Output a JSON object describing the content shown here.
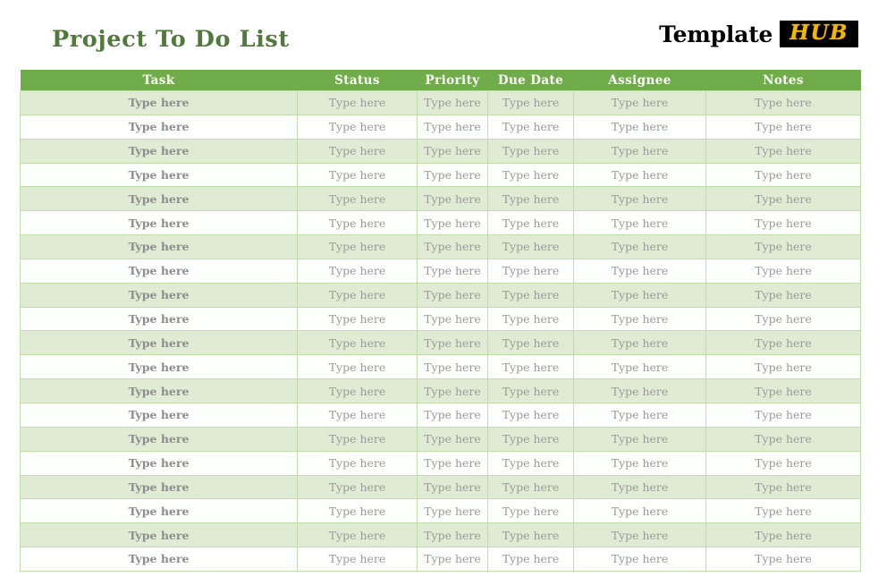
{
  "page": {
    "title": "Project To Do List"
  },
  "brand": {
    "word": "Template",
    "badge": "HUB",
    "badge_color": "#f2b705",
    "badge_bg": "#000000",
    "word_color": "#000000"
  },
  "theme": {
    "title_color": "#4f7a3a",
    "header_bg": "#71ac4a",
    "header_text": "#ffffff",
    "row_alt_bg": "#dfecd3",
    "row_plain_bg": "#fdfffc",
    "border_color": "#c3dcab",
    "cell_text": "#9a9a9a"
  },
  "table": {
    "columns": [
      {
        "key": "task",
        "label": "Task"
      },
      {
        "key": "status",
        "label": "Status"
      },
      {
        "key": "priority",
        "label": "Priority"
      },
      {
        "key": "duedate",
        "label": "Due Date"
      },
      {
        "key": "assignee",
        "label": "Assignee"
      },
      {
        "key": "notes",
        "label": "Notes"
      }
    ],
    "placeholder": "Type here",
    "row_count": 20,
    "rows": [
      {
        "task": "Type here",
        "status": "Type here",
        "priority": "Type here",
        "duedate": "Type here",
        "assignee": "Type here",
        "notes": "Type here"
      },
      {
        "task": "Type here",
        "status": "Type here",
        "priority": "Type here",
        "duedate": "Type here",
        "assignee": "Type here",
        "notes": "Type here"
      },
      {
        "task": "Type here",
        "status": "Type here",
        "priority": "Type here",
        "duedate": "Type here",
        "assignee": "Type here",
        "notes": "Type here"
      },
      {
        "task": "Type here",
        "status": "Type here",
        "priority": "Type here",
        "duedate": "Type here",
        "assignee": "Type here",
        "notes": "Type here"
      },
      {
        "task": "Type here",
        "status": "Type here",
        "priority": "Type here",
        "duedate": "Type here",
        "assignee": "Type here",
        "notes": "Type here"
      },
      {
        "task": "Type here",
        "status": "Type here",
        "priority": "Type here",
        "duedate": "Type here",
        "assignee": "Type here",
        "notes": "Type here"
      },
      {
        "task": "Type here",
        "status": "Type here",
        "priority": "Type here",
        "duedate": "Type here",
        "assignee": "Type here",
        "notes": "Type here"
      },
      {
        "task": "Type here",
        "status": "Type here",
        "priority": "Type here",
        "duedate": "Type here",
        "assignee": "Type here",
        "notes": "Type here"
      },
      {
        "task": "Type here",
        "status": "Type here",
        "priority": "Type here",
        "duedate": "Type here",
        "assignee": "Type here",
        "notes": "Type here"
      },
      {
        "task": "Type here",
        "status": "Type here",
        "priority": "Type here",
        "duedate": "Type here",
        "assignee": "Type here",
        "notes": "Type here"
      },
      {
        "task": "Type here",
        "status": "Type here",
        "priority": "Type here",
        "duedate": "Type here",
        "assignee": "Type here",
        "notes": "Type here"
      },
      {
        "task": "Type here",
        "status": "Type here",
        "priority": "Type here",
        "duedate": "Type here",
        "assignee": "Type here",
        "notes": "Type here"
      },
      {
        "task": "Type here",
        "status": "Type here",
        "priority": "Type here",
        "duedate": "Type here",
        "assignee": "Type here",
        "notes": "Type here"
      },
      {
        "task": "Type here",
        "status": "Type here",
        "priority": "Type here",
        "duedate": "Type here",
        "assignee": "Type here",
        "notes": "Type here"
      },
      {
        "task": "Type here",
        "status": "Type here",
        "priority": "Type here",
        "duedate": "Type here",
        "assignee": "Type here",
        "notes": "Type here"
      },
      {
        "task": "Type here",
        "status": "Type here",
        "priority": "Type here",
        "duedate": "Type here",
        "assignee": "Type here",
        "notes": "Type here"
      },
      {
        "task": "Type here",
        "status": "Type here",
        "priority": "Type here",
        "duedate": "Type here",
        "assignee": "Type here",
        "notes": "Type here"
      },
      {
        "task": "Type here",
        "status": "Type here",
        "priority": "Type here",
        "duedate": "Type here",
        "assignee": "Type here",
        "notes": "Type here"
      },
      {
        "task": "Type here",
        "status": "Type here",
        "priority": "Type here",
        "duedate": "Type here",
        "assignee": "Type here",
        "notes": "Type here"
      },
      {
        "task": "Type here",
        "status": "Type here",
        "priority": "Type here",
        "duedate": "Type here",
        "assignee": "Type here",
        "notes": "Type here"
      }
    ]
  }
}
